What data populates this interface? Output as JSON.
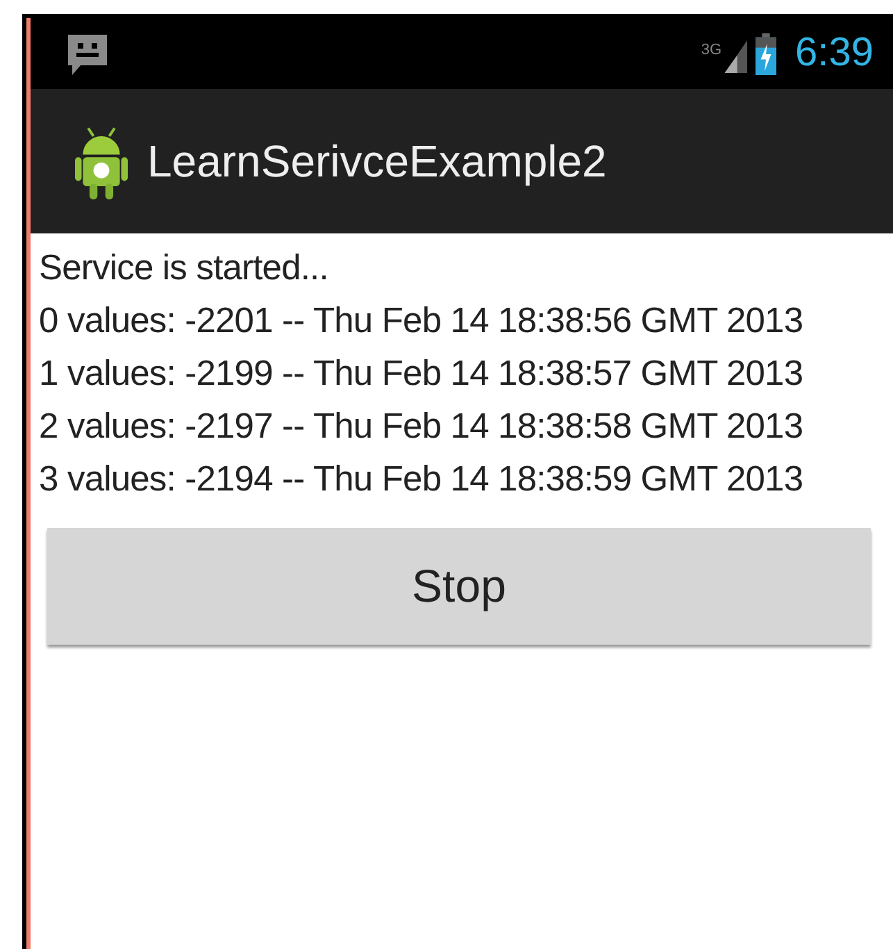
{
  "status_bar": {
    "network": "3G",
    "time": "6:39"
  },
  "action_bar": {
    "title": "LearnSerivceExample2"
  },
  "log_lines": [
    "Service is started...",
    "0 values: -2201 -- Thu Feb 14 18:38:56 GMT 2013",
    "1 values: -2199 -- Thu Feb 14 18:38:57 GMT 2013",
    "2 values: -2197 -- Thu Feb 14 18:38:58 GMT 2013",
    "3 values: -2194 -- Thu Feb 14 18:38:59 GMT 2013"
  ],
  "buttons": [
    "Stop"
  ]
}
